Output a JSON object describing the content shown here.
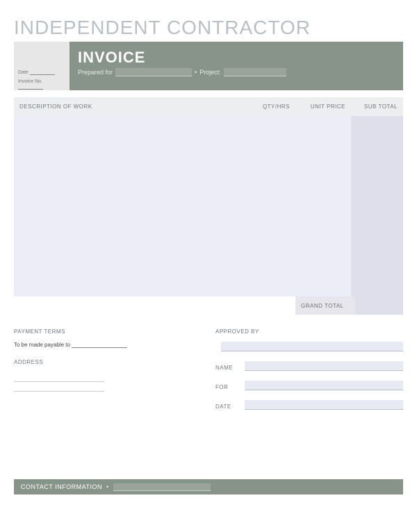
{
  "title": "INDEPENDENT CONTRACTOR",
  "header": {
    "date_label": "Date",
    "invoice_no_label": "Invoice No.",
    "invoice_word": "INVOICE",
    "prepared_for_label": "Prepared for",
    "project_label": "Project:",
    "separator": "•"
  },
  "columns": {
    "description": "DESCRIPTION OF WORK",
    "qty": "QTY/HRS",
    "unit": "UNIT PRICE",
    "subtotal": "SUB TOTAL"
  },
  "grand_total_label": "GRAND TOTAL",
  "payment": {
    "title": "PAYMENT TERMS",
    "payable_text": "To be made payable to",
    "address_title": "ADDRESS"
  },
  "approved": {
    "title": "APPROVED BY",
    "name": "NAME",
    "for": "FOR",
    "date": "DATE"
  },
  "footer": {
    "label": "CONTACT INFORMATION",
    "separator": "•"
  }
}
